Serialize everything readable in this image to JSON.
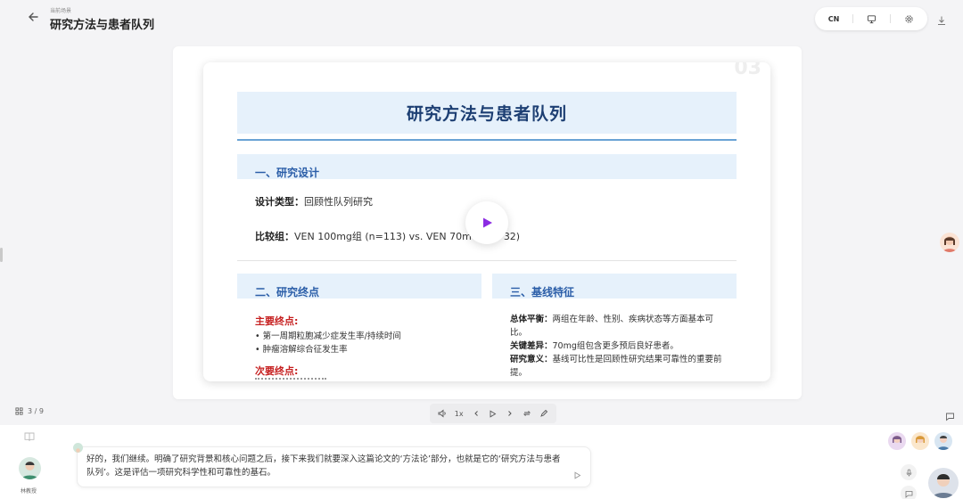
{
  "header": {
    "scene_label": "当前场景",
    "title": "研究方法与患者队列",
    "tools": [
      {
        "label": "CN",
        "icon": "language-toggle"
      },
      {
        "label": "",
        "icon": "monitor-icon"
      },
      {
        "label": "",
        "icon": "gear-icon"
      }
    ],
    "download_icon": "download-icon"
  },
  "slide": {
    "number": "03",
    "title": "研究方法与患者队列",
    "section1": {
      "heading": "一、研究设计",
      "design_label": "设计类型：",
      "design_value": "回顾性队列研究",
      "compare_label": "比较组：",
      "compare_value": "VEN 100mg组 (n=113) vs. VEN 70m",
      "compare_tail": "32)"
    },
    "section2": {
      "heading": "二、研究终点",
      "primary_label": "主要终点:",
      "primary_items": [
        "• 第一周期粒胞减少症发生率/持续时间",
        "• 肿瘤溶解综合征发生率"
      ],
      "secondary_label": "次要终点:"
    },
    "section3": {
      "heading": "三、基线特征",
      "balance_label": "总体平衡：",
      "balance_value": "两组在年龄、性别、疾病状态等方面基本可比。",
      "diff_label": "关键差异：",
      "diff_value": "70mg组包含更多预后良好患者。",
      "meaning_label": "研究意义：",
      "meaning_value": "基线可比性是回顾性研究结果可靠性的重要前提。"
    }
  },
  "controls": {
    "page_indicator": "3 / 9",
    "speed": "1x"
  },
  "chat": {
    "host_name": "林教授",
    "message": "好的，我们继续。明确了研究背景和核心问题之后，接下来我们就要深入这篇论文的‘方法论’部分，也就是它的‘研究方法与患者队列’。这是评估一项研究科学性和可靠性的基石。"
  },
  "colors": {
    "accent_blue": "#2b5ea8",
    "title_navy": "#1d3f73",
    "band_light": "#e6f1fb",
    "endpoint_red": "#c62020",
    "play_purple": "#8b2be2"
  }
}
